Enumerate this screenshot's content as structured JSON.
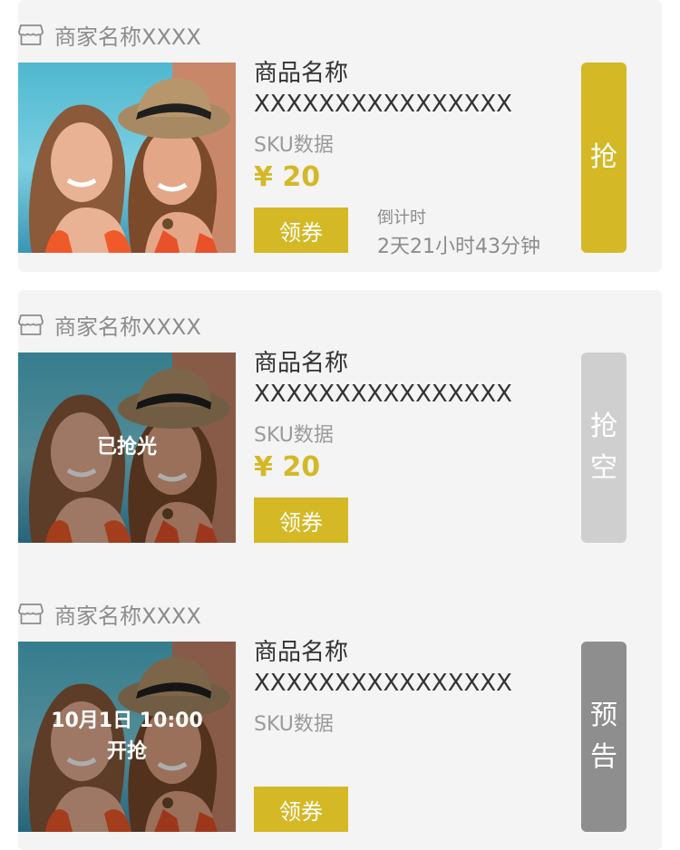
{
  "items": [
    {
      "shop_name": "商家名称XXXX",
      "product_name": "商品名称XXXXXXXXXXXXXXXX",
      "sku": "SKU数据",
      "price": "¥ 20",
      "coupon_label": "领券",
      "countdown_label": "倒计时",
      "countdown_value": "2天21小时43分钟",
      "action_label": "抢",
      "action_color": "#d4b826"
    },
    {
      "shop_name": "商家名称XXXX",
      "product_name": "商品名称XXXXXXXXXXXXXXXX",
      "sku": "SKU数据",
      "price": "¥ 20",
      "coupon_label": "领券",
      "overlay_text": "已抢光",
      "action_label": "抢空",
      "action_color": "#cfcfcf"
    },
    {
      "shop_name": "商家名称XXXX",
      "product_name": "商品名称XXXXXXXXXXXXXXXX",
      "sku": "SKU数据",
      "coupon_label": "领券",
      "overlay_line1": "10月1日 10:00",
      "overlay_line2": "开抢",
      "action_label": "预告",
      "action_color": "#8e8e8e"
    }
  ],
  "icons": {
    "shop": "shop-icon"
  },
  "colors": {
    "accent": "#d4b826",
    "background": "#f4f4f4"
  }
}
